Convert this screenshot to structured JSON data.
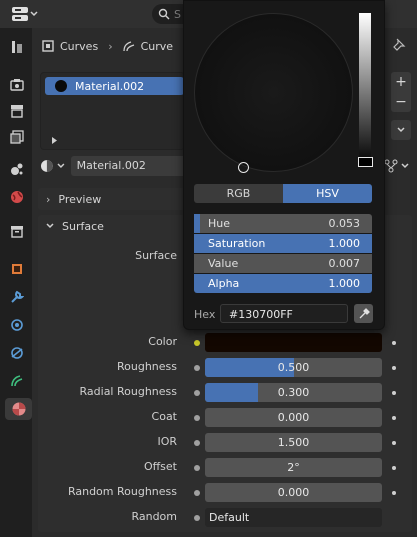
{
  "breadcrumb": {
    "object": "Curves",
    "data": "Curve"
  },
  "search": {
    "placeholder": "S"
  },
  "material_slot": {
    "name": "Material.002"
  },
  "material_selector": {
    "name": "Material.002"
  },
  "panels": {
    "preview": "Preview",
    "surface": "Surface"
  },
  "surface_label": "Surface",
  "properties": [
    {
      "label": "Color",
      "type": "color",
      "color": "#130700"
    },
    {
      "label": "Roughness",
      "value": "0.500",
      "fill": 0.5
    },
    {
      "label": "Radial Roughness",
      "value": "0.300",
      "fill": 0.3
    },
    {
      "label": "Coat",
      "value": "0.000",
      "fill": 0
    },
    {
      "label": "IOR",
      "value": "1.500",
      "fill": 0
    },
    {
      "label": "Offset",
      "value": "2°",
      "fill": 0
    },
    {
      "label": "Random Roughness",
      "value": "0.000",
      "fill": 0
    },
    {
      "label": "Random",
      "value": "Default",
      "type": "link"
    }
  ],
  "color_picker": {
    "tabs": [
      "RGB",
      "HSV"
    ],
    "active_tab": "HSV",
    "hue_label": "Hue",
    "hue": "0.053",
    "hue_fill": 0.053,
    "saturation_label": "Saturation",
    "saturation": "1.000",
    "saturation_fill": 1.0,
    "value_label": "Value",
    "value": "0.007",
    "value_fill": 0.007,
    "alpha_label": "Alpha",
    "alpha": "1.000",
    "alpha_fill": 1.0,
    "hex_label": "Hex",
    "hex_value": "#130700FF"
  },
  "colors": {
    "accent": "#4772b3",
    "field": "#545454",
    "panel": "#2e2e2e"
  },
  "icons": [
    "editor-type-icon",
    "search-icon",
    "tool-icon",
    "render-icon",
    "output-icon",
    "view-layer-icon",
    "scene-icon",
    "world-icon",
    "collection-icon",
    "object-icon",
    "modifier-icon",
    "particles-icon",
    "physics-icon",
    "constraints-icon",
    "data-icon",
    "material-icon",
    "pin-icon",
    "add-icon",
    "remove-icon",
    "chevron-down-icon",
    "eyedropper-icon",
    "node-tree-icon"
  ]
}
